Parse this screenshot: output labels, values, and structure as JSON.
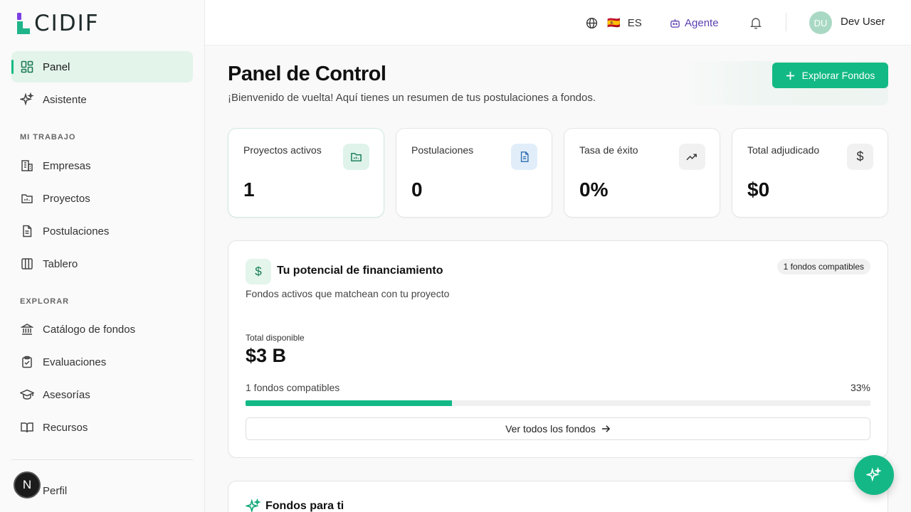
{
  "app": {
    "logo_text": "CIDIF"
  },
  "sidebar": {
    "primary": [
      {
        "label": "Panel",
        "icon": "dashboard-icon",
        "active": true
      },
      {
        "label": "Asistente",
        "icon": "sparkles-icon"
      }
    ],
    "section_work": "MI TRABAJO",
    "work": [
      {
        "label": "Empresas",
        "icon": "building-icon"
      },
      {
        "label": "Proyectos",
        "icon": "folder-icon"
      },
      {
        "label": "Postulaciones",
        "icon": "document-icon"
      },
      {
        "label": "Tablero",
        "icon": "columns-icon"
      }
    ],
    "section_explore": "EXPLORAR",
    "explore": [
      {
        "label": "Catálogo de fondos",
        "icon": "bank-icon"
      },
      {
        "label": "Evaluaciones",
        "icon": "clipboard-check-icon"
      },
      {
        "label": "Asesorías",
        "icon": "graduation-cap-icon"
      },
      {
        "label": "Recursos",
        "icon": "book-icon"
      }
    ],
    "profile_label": "Perfil",
    "profile_avatar": "N"
  },
  "topbar": {
    "language_flag": "🇪🇸",
    "language_code": "ES",
    "agent_label": "Agente",
    "user_initials": "DU",
    "user_name": "Dev User"
  },
  "main": {
    "title": "Panel de Control",
    "subtitle": "¡Bienvenido de vuelta! Aquí tienes un resumen de tus postulaciones a fondos.",
    "explore_button": "Explorar Fondos",
    "stats": [
      {
        "label": "Proyectos activos",
        "value": "1",
        "icon": "folder-icon",
        "icon_bg": "#dff3ea",
        "icon_color": "#117a55"
      },
      {
        "label": "Postulaciones",
        "value": "0",
        "icon": "document-icon",
        "icon_bg": "#e1eefa",
        "icon_color": "#2b6cb0"
      },
      {
        "label": "Tasa de éxito",
        "value": "0%",
        "icon": "trending-up-icon",
        "icon_bg": "#f1f1f1",
        "icon_color": "#333333"
      },
      {
        "label": "Total adjudicado",
        "value": "$0",
        "icon": "dollar-icon",
        "icon_bg": "#f1f1f1",
        "icon_color": "#333333"
      }
    ],
    "funding": {
      "title": "Tu potencial de financiamiento",
      "badge": "1 fondos compatibles",
      "subtitle": "Fondos activos que matchean con tu proyecto",
      "total_label": "Total disponible",
      "total_value": "$3 B",
      "progress_label": "1 fondos compatibles",
      "progress_pct_text": "33%",
      "progress_fraction": 0.33,
      "view_all_button": "Ver todos los fondos"
    },
    "for_you": {
      "title": "Fondos para ti"
    }
  },
  "colors": {
    "accent": "#13b984",
    "agent": "#5b3fb0"
  }
}
